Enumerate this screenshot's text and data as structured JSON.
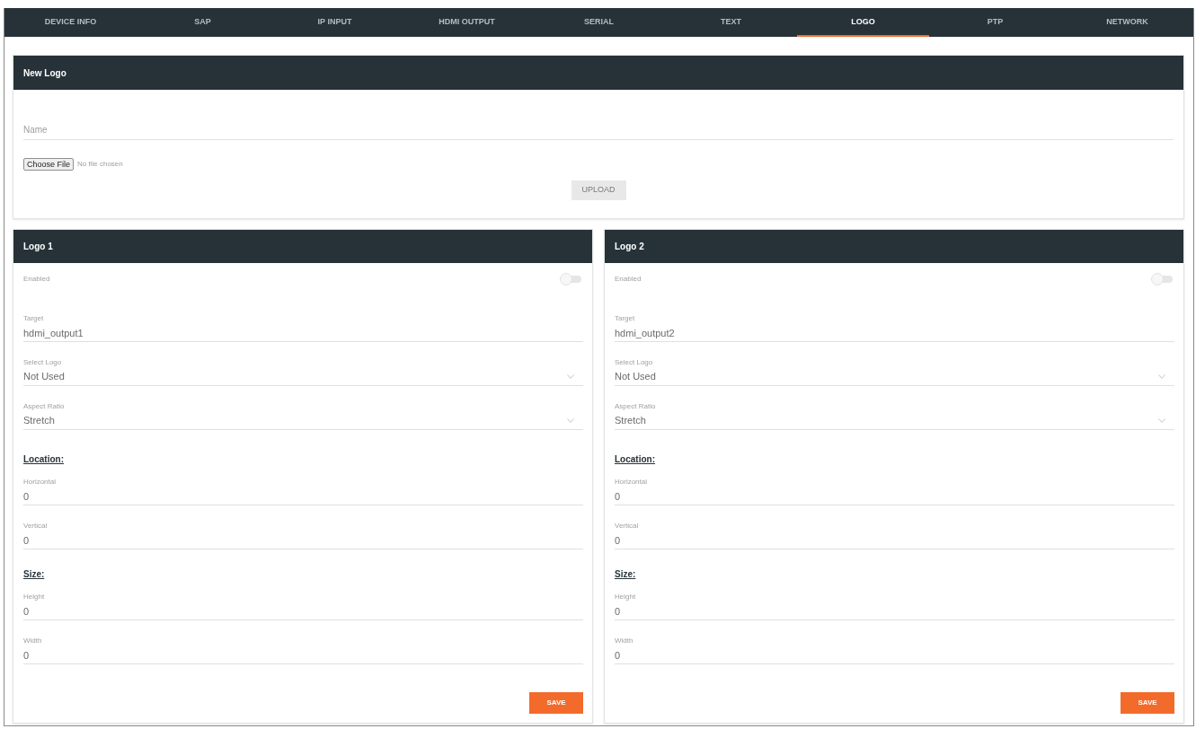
{
  "tabs": [
    {
      "label": "DEVICE INFO",
      "selected": false
    },
    {
      "label": "SAP",
      "selected": false
    },
    {
      "label": "IP INPUT",
      "selected": false
    },
    {
      "label": "HDMI OUTPUT",
      "selected": false
    },
    {
      "label": "SERIAL",
      "selected": false
    },
    {
      "label": "TEXT",
      "selected": false
    },
    {
      "label": "LOGO",
      "selected": true
    },
    {
      "label": "PTP",
      "selected": false
    },
    {
      "label": "NETWORK",
      "selected": false
    }
  ],
  "new_logo": {
    "title": "New Logo",
    "name_field": {
      "placeholder": "Name"
    },
    "file_button": "Choose File",
    "file_status": "No file chosen",
    "upload_button": {
      "label": "UPLOAD",
      "disabled": true
    }
  },
  "logos": [
    {
      "title": "Logo 1",
      "enabled": {
        "label": "Enabled",
        "on": false
      },
      "fields": [
        {
          "kind": "text",
          "label": "Target",
          "value": "hdmi_output1"
        },
        {
          "kind": "select",
          "label": "Select Logo",
          "value": "Not Used"
        },
        {
          "kind": "select",
          "label": "Aspect Ratio",
          "value": "Stretch"
        },
        {
          "kind": "heading",
          "label": "Location:"
        },
        {
          "kind": "text",
          "label": "Horizontal",
          "value": "0"
        },
        {
          "kind": "text",
          "label": "Vertical",
          "value": "0"
        },
        {
          "kind": "heading",
          "label": "Size:"
        },
        {
          "kind": "text",
          "label": "Height",
          "value": "0"
        },
        {
          "kind": "text",
          "label": "Width",
          "value": "0"
        }
      ],
      "save_button": "SAVE"
    },
    {
      "title": "Logo 2",
      "enabled": {
        "label": "Enabled",
        "on": false
      },
      "fields": [
        {
          "kind": "text",
          "label": "Target",
          "value": "hdmi_output2"
        },
        {
          "kind": "select",
          "label": "Select Logo",
          "value": "Not Used"
        },
        {
          "kind": "select",
          "label": "Aspect Ratio",
          "value": "Stretch"
        },
        {
          "kind": "heading",
          "label": "Location:"
        },
        {
          "kind": "text",
          "label": "Horizontal",
          "value": "0"
        },
        {
          "kind": "text",
          "label": "Vertical",
          "value": "0"
        },
        {
          "kind": "heading",
          "label": "Size:"
        },
        {
          "kind": "text",
          "label": "Height",
          "value": "0"
        },
        {
          "kind": "text",
          "label": "Width",
          "value": "0"
        }
      ],
      "save_button": "SAVE"
    }
  ]
}
